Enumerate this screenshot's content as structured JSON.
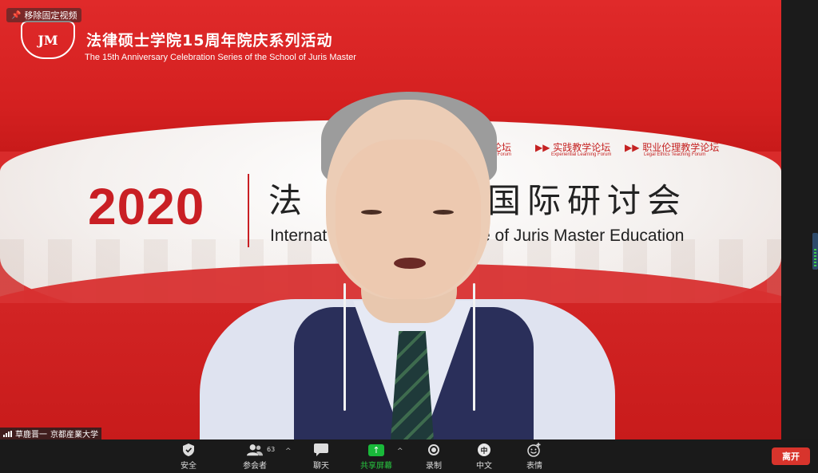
{
  "overlay": {
    "unpin_label": "移除固定视频"
  },
  "slide": {
    "logo_text": "JM",
    "title_cn": "法律硕士学院15周年院庆系列活动",
    "title_en": "The 15th Anniversary Celebration Series of the School of Juris Master",
    "forums": [
      {
        "cn": "长论坛",
        "en": "s Forum"
      },
      {
        "cn": "▶▶ 实践教学论坛",
        "en": "Experiential Learning Forum"
      },
      {
        "cn": "▶▶ 职业伦理教学论坛",
        "en": "Legal Ethics Teaching Forum"
      }
    ],
    "year": "2020",
    "conf_cn_left": "法",
    "conf_cn_right": "国际研讨会",
    "conf_en_left": "Internat",
    "conf_en_right": "e of Juris Master Education"
  },
  "participant": {
    "name": "草鹿晋一",
    "org": "京都産業大学"
  },
  "toolbar": {
    "security": "安全",
    "participants": "参会者",
    "participant_count": "63",
    "chat": "聊天",
    "share": "共享屏幕",
    "record": "录制",
    "language": "中文",
    "language_icon": "中",
    "reactions": "表情",
    "leave": "离开"
  },
  "colors": {
    "brand_red": "#d92b2b",
    "share_green": "#19b93a",
    "leave_red": "#d8342c"
  }
}
